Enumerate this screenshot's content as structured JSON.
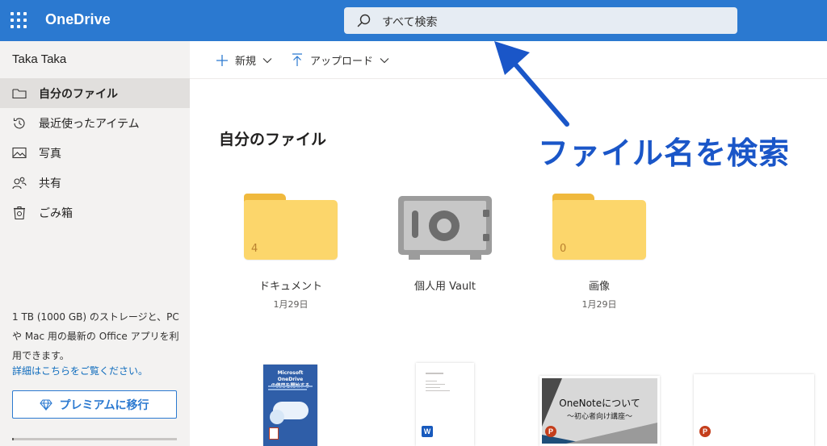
{
  "app": {
    "name": "OneDrive"
  },
  "search": {
    "placeholder": "すべて検索"
  },
  "sidebar": {
    "user_name": "Taka Taka",
    "items": [
      {
        "label": "自分のファイル",
        "icon": "folder-icon",
        "selected": true
      },
      {
        "label": "最近使ったアイテム",
        "icon": "history-icon",
        "selected": false
      },
      {
        "label": "写真",
        "icon": "photo-icon",
        "selected": false
      },
      {
        "label": "共有",
        "icon": "people-icon",
        "selected": false
      },
      {
        "label": "ごみ箱",
        "icon": "recycle-bin-icon",
        "selected": false
      }
    ],
    "storage_text": "1 TB (1000 GB) のストレージと、PC や Mac 用の最新の Office アプリを利用できます。",
    "details_link": "詳細はこちらをご覧ください。",
    "premium_button": "プレミアムに移行",
    "storage_used_fraction": 0.01
  },
  "toolbar": {
    "new_label": "新規",
    "upload_label": "アップロード"
  },
  "main": {
    "title": "自分のファイル",
    "items": [
      {
        "name": "ドキュメント",
        "date": "1月29日",
        "count": "4",
        "type": "folder"
      },
      {
        "name": "個人用 Vault",
        "date": "",
        "type": "vault"
      },
      {
        "name": "画像",
        "date": "1月29日",
        "count": "0",
        "type": "folder"
      }
    ],
    "thumbnails": [
      {
        "type": "word-cover",
        "line1": "Microsoft OneDrive",
        "line2": "の使用を開始する"
      },
      {
        "type": "word-doc"
      },
      {
        "type": "powerpoint",
        "title": "OneNoteについて",
        "subtitle": "〜初心者向け講座〜"
      },
      {
        "type": "powerpoint-blank"
      }
    ]
  },
  "annotation": {
    "text": "ファイル名を検索",
    "color": "#1a56c8"
  },
  "colors": {
    "accent": "#2b79d0",
    "sidebar_bg": "#f3f2f1",
    "selected_bg": "#e1dfdd",
    "folder": "#fcd66b"
  }
}
